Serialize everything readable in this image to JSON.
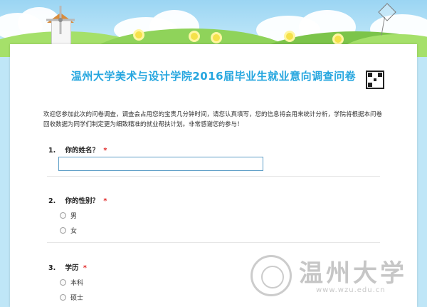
{
  "survey": {
    "title": "温州大学美术与设计学院2016届毕业生就业意向调查问卷",
    "intro": "欢迎您参加此次的问卷调查，调查会占用您的宝贵几分钟时间，请您认真填写，您的信息将会用来统计分析，学院将根据本问卷回收数据为同学们制定更为细致精准的就业帮扶计划。非常感谢您的参与！",
    "required_mark": "*"
  },
  "questions": [
    {
      "number": "1.",
      "label": "你的姓名？",
      "input_value": ""
    },
    {
      "number": "2.",
      "label": "你的性别？",
      "options": [
        "男",
        "女"
      ]
    },
    {
      "number": "3.",
      "label": "学历",
      "options": [
        "本科",
        "硕士"
      ]
    }
  ],
  "watermark": {
    "text": "温州大学",
    "url": "www.wzu.edu.cn"
  },
  "colors": {
    "title": "#25a6df",
    "required": "#e02020",
    "input_border": "#5d9ec7"
  },
  "icons": {
    "qr": "qr-code-icon",
    "kite": "kite-icon",
    "windmill": "windmill-icon",
    "seal": "university-seal-icon"
  }
}
